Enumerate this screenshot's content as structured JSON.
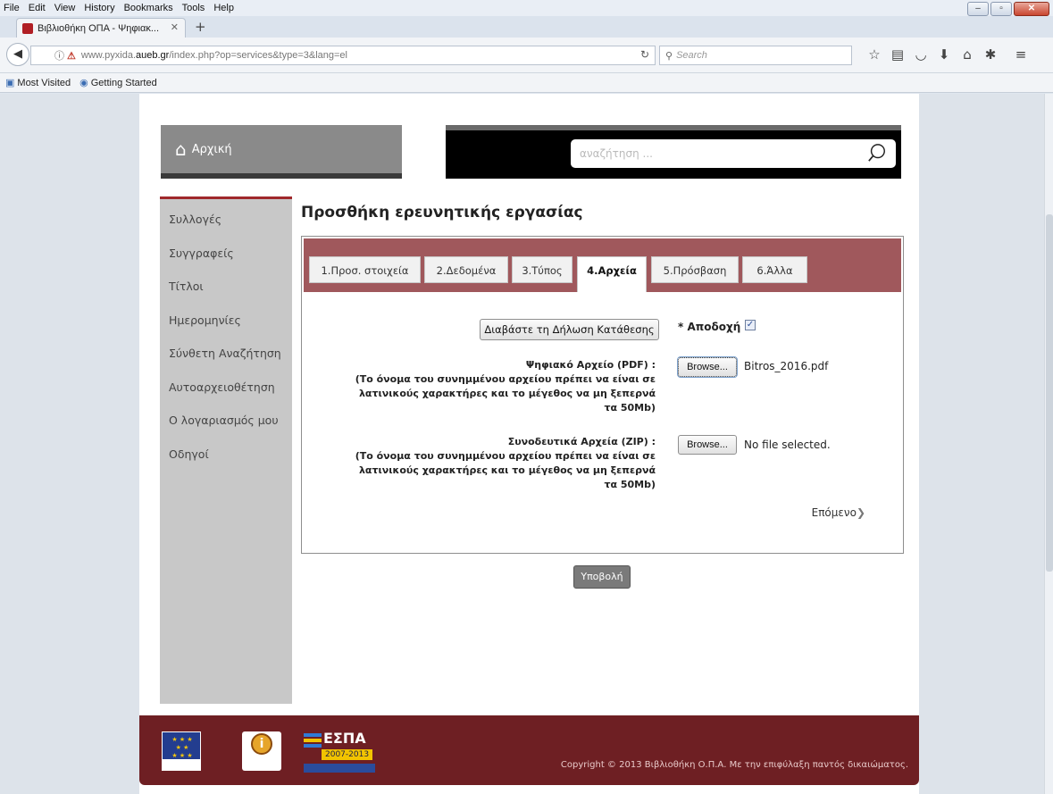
{
  "browser": {
    "menu": [
      "File",
      "Edit",
      "View",
      "History",
      "Bookmarks",
      "Tools",
      "Help"
    ],
    "tab_title": "Βιβλιοθήκη ΟΠΑ - Ψηφιακ...",
    "url_prefix": "www.pyxida.",
    "url_domain": "aueb.gr",
    "url_suffix": "/index.php?op=services&type=3&lang=el",
    "search_placeholder": "Search",
    "bookmarks": [
      "Most Visited",
      "Getting Started"
    ]
  },
  "site": {
    "home_label": "Αρχική",
    "search_placeholder": "αναζήτηση ..."
  },
  "sidebar": {
    "items": [
      {
        "label": "Συλλογές"
      },
      {
        "label": "Συγγραφείς"
      },
      {
        "label": "Τίτλοι"
      },
      {
        "label": "Ημερομηνίες"
      },
      {
        "label": "Σύνθετη Αναζήτηση"
      },
      {
        "label": "Αυτοαρχειοθέτηση"
      },
      {
        "label": "Ο λογαριασμός μου"
      },
      {
        "label": "Οδηγοί"
      }
    ]
  },
  "main": {
    "title": "Προσθήκη ερευνητικής εργασίας",
    "tabs": [
      {
        "label": "1.Προσ. στοιχεία"
      },
      {
        "label": "2.Δεδομένα"
      },
      {
        "label": "3.Τύπος"
      },
      {
        "label": "4.Αρχεία"
      },
      {
        "label": "5.Πρόσβαση"
      },
      {
        "label": "6.Άλλα"
      }
    ],
    "read_declaration_button": "Διαβάστε τη Δήλωση Κατάθεσης",
    "accept_label": "* Αποδοχή",
    "accept_checked": true,
    "pdf_label": "Ψηφιακό Αρχείο (PDF) :",
    "pdf_note": "(Το όνομα του συνημμένου αρχείου πρέπει να είναι σε λατινικούς χαρακτήρες και το μέγεθος να μη ξεπερνά τα 50Mb)",
    "pdf_browse": "Browse...",
    "pdf_file": "Bitros_2016.pdf",
    "zip_label": "Συνοδευτικά Αρχεία (ZIP) :",
    "zip_note": "(Το όνομα του συνημμένου αρχείου πρέπει να είναι σε λατινικούς χαρακτήρες και το μέγεθος να μη ξεπερνά τα 50Mb)",
    "zip_browse": "Browse...",
    "zip_file": "No file selected.",
    "next_label": "Επόμενο",
    "submit_label": "Υποβολή"
  },
  "footer": {
    "copyright": "Copyright © 2013 Βιβλιοθήκη Ο.Π.Α. Με την επιφύλαξη παντός δικαιώματος.",
    "espa_text": "ΕΣΠΑ",
    "espa_years": "2007-2013"
  },
  "colors": {
    "accent": "#a0585c",
    "footer": "#6e1f23",
    "sidebar": "#c8c8c8"
  }
}
